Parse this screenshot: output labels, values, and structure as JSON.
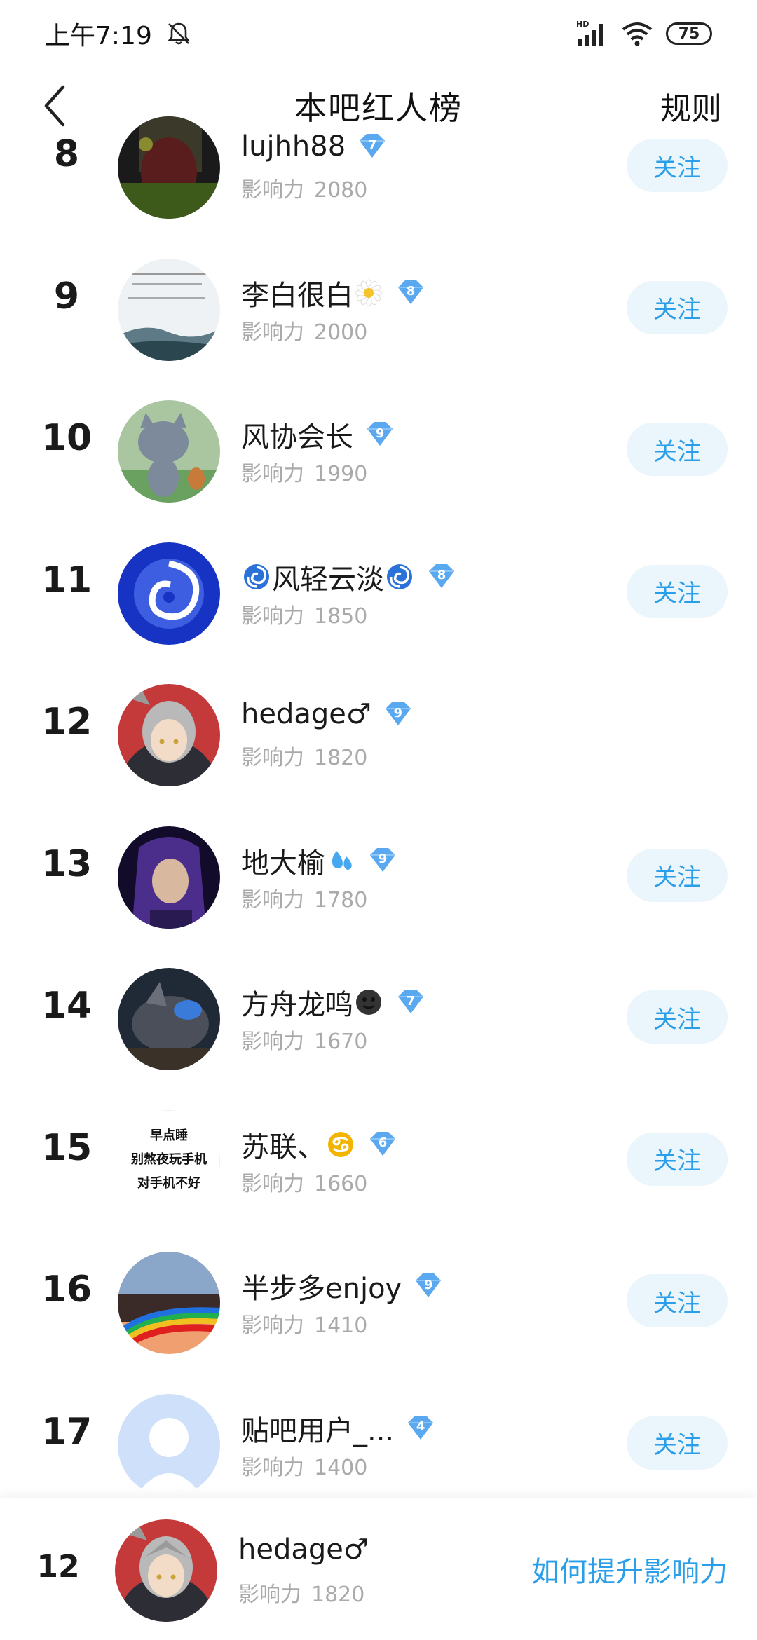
{
  "status": {
    "time": "上午7:19",
    "battery": "75"
  },
  "nav": {
    "title": "本吧红人榜",
    "rule": "规则"
  },
  "labels": {
    "influence": "影响力",
    "follow": "关注"
  },
  "rows": [
    {
      "rank": "8",
      "name": "lujhh88",
      "level": "7",
      "influence": "2080",
      "emoji": "",
      "follow": true
    },
    {
      "rank": "9",
      "name": "李白很白",
      "level": "8",
      "influence": "2000",
      "emoji": "daisy",
      "follow": true
    },
    {
      "rank": "10",
      "name": "风协会长",
      "level": "9",
      "influence": "1990",
      "emoji": "",
      "follow": true
    },
    {
      "rank": "11",
      "name": "风轻云淡",
      "level": "8",
      "influence": "1850",
      "emoji": "cyclone",
      "follow": true
    },
    {
      "rank": "12",
      "name": "hedage♂",
      "level": "9",
      "influence": "1820",
      "emoji": "",
      "follow": false
    },
    {
      "rank": "13",
      "name": "地大榆",
      "level": "9",
      "influence": "1780",
      "emoji": "droplets",
      "follow": true
    },
    {
      "rank": "14",
      "name": "方舟龙鸣",
      "level": "7",
      "influence": "1670",
      "emoji": "dark-face",
      "follow": true
    },
    {
      "rank": "15",
      "name": "苏联、",
      "level": "6",
      "influence": "1660",
      "emoji": "cancer",
      "follow": true
    },
    {
      "rank": "16",
      "name": "半步多enjoy",
      "level": "9",
      "influence": "1410",
      "emoji": "",
      "follow": true
    },
    {
      "rank": "17",
      "name": "贴吧用户_...",
      "level": "4",
      "influence": "1400",
      "emoji": "",
      "follow": true
    }
  ],
  "avatar15_text": [
    "早点睡",
    "别熬夜玩手机",
    "对手机不好"
  ],
  "me": {
    "rank": "12",
    "name": "hedage♂",
    "influence": "1820",
    "how": "如何提升影响力"
  },
  "colors": {
    "accent": "#2a9ee8",
    "follow_bg": "#eaf5fc",
    "level_badge": "#5aa8f0"
  }
}
